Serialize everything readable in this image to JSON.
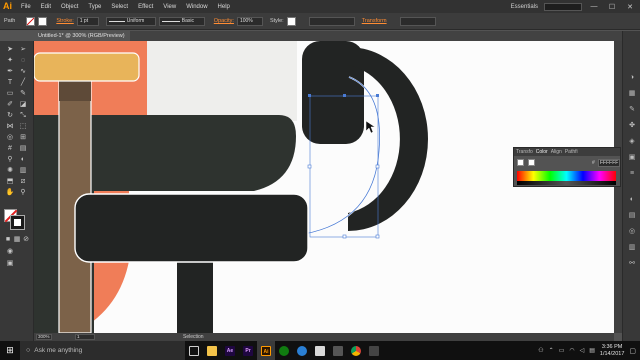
{
  "app": {
    "logo": "Ai"
  },
  "menu": {
    "items": [
      "File",
      "Edit",
      "Object",
      "Type",
      "Select",
      "Effect",
      "View",
      "Window",
      "Help"
    ],
    "workspace": "Essentials",
    "window_min": "—",
    "window_max": "☐",
    "window_close": "✕"
  },
  "control": {
    "selection_label": "Path",
    "stroke_label": "Stroke:",
    "stroke_weight": "1 pt",
    "profile": "Uniform",
    "brush": "Basic",
    "opacity_label": "Opacity:",
    "opacity_value": "100%",
    "style_label": "Style:",
    "transform_label": "Transform"
  },
  "document": {
    "tab_title": "Untitled-1* @ 300% (RGB/Preview)"
  },
  "status": {
    "zoom": "300%",
    "page": "1",
    "tool": "Selection"
  },
  "color_panel": {
    "tabs": [
      "Transfo",
      "Color",
      "Align",
      "Pathfi"
    ],
    "hex_label": "#",
    "hex_value": "FFFFFF"
  },
  "taskbar": {
    "search_placeholder": "Ask me anything",
    "apps": [
      {
        "label": "Ae",
        "bg": "#1f0740",
        "fg": "#d59bff"
      },
      {
        "label": "Pr",
        "bg": "#1f0740",
        "fg": "#e29cff"
      },
      {
        "label": "Ai",
        "bg": "#2b1500",
        "fg": "#ff9a00"
      }
    ],
    "time": "3:36 PM",
    "date": "1/14/2017"
  },
  "colors": {
    "accent": "#ff9a00",
    "coral": "#f07d58",
    "amber": "#e8b45a",
    "olive": "#7c6249",
    "dark": "#222423",
    "slate": "#2e332f",
    "selection": "#4a7bd4"
  }
}
